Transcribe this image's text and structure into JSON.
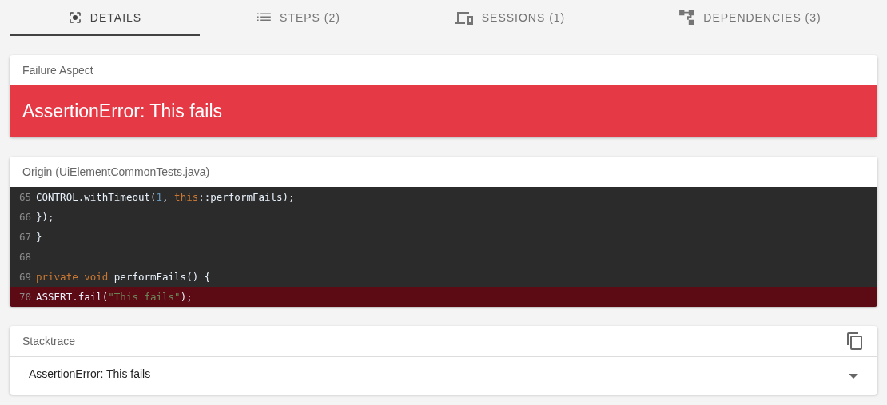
{
  "tabs": [
    {
      "label": "DETAILS",
      "kind": "focus",
      "selected": true
    },
    {
      "label": "STEPS (2)",
      "kind": "list",
      "selected": false
    },
    {
      "label": "SESSIONS (1)",
      "kind": "devices",
      "selected": false
    },
    {
      "label": "DEPENDENCIES (3)",
      "kind": "tree",
      "selected": false
    }
  ],
  "failure_aspect": {
    "title": "Failure Aspect",
    "message": "AssertionError: This fails"
  },
  "origin": {
    "title": "Origin (UiElementCommonTests.java)",
    "lines": [
      {
        "number": "65",
        "highlighted": false,
        "tokens": [
          {
            "kind": "plain",
            "text": "CONTROL.withTimeout("
          },
          {
            "kind": "number",
            "text": "1"
          },
          {
            "kind": "plain",
            "text": ", "
          },
          {
            "kind": "keyword",
            "text": "this"
          },
          {
            "kind": "plain",
            "text": "::performFails);"
          }
        ]
      },
      {
        "number": "66",
        "highlighted": false,
        "tokens": [
          {
            "kind": "plain",
            "text": "});"
          }
        ]
      },
      {
        "number": "67",
        "highlighted": false,
        "tokens": [
          {
            "kind": "plain",
            "text": "}"
          }
        ]
      },
      {
        "number": "68",
        "highlighted": false
      },
      {
        "number": "69",
        "highlighted": false,
        "tokens": [
          {
            "kind": "keyword",
            "text": "private void"
          },
          {
            "kind": "plain",
            "text": " performFails() {"
          }
        ]
      },
      {
        "number": "70",
        "highlighted": true,
        "tokens": [
          {
            "kind": "plain",
            "text": "ASSERT.fail("
          },
          {
            "kind": "string",
            "text": "\"This fails\""
          },
          {
            "kind": "plain",
            "text": ");"
          }
        ]
      }
    ]
  },
  "stacktrace": {
    "title": "Stacktrace",
    "summary": "AssertionError: This fails",
    "expanded": false
  }
}
